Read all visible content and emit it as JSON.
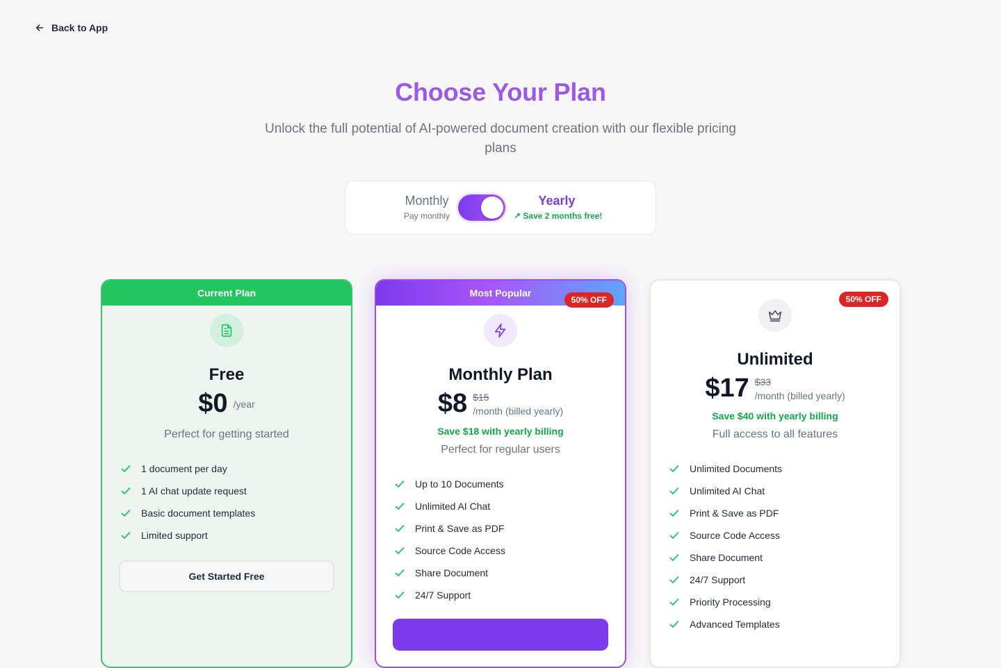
{
  "nav": {
    "back_label": "Back to App"
  },
  "hero": {
    "title": "Choose Your Plan",
    "subtitle": "Unlock the full potential of AI-powered document creation with our flexible pricing plans"
  },
  "billing_toggle": {
    "monthly_label": "Monthly",
    "monthly_sub": "Pay monthly",
    "yearly_label": "Yearly",
    "yearly_sub": "↗ Save 2 months free!",
    "selected": "Yearly"
  },
  "plans": {
    "free": {
      "banner": "Current Plan",
      "icon": "document-icon",
      "name": "Free",
      "price": "$0",
      "period": "/year",
      "tagline": "Perfect for getting started",
      "features": [
        "1 document per day",
        "1 AI chat update request",
        "Basic document templates",
        "Limited support"
      ],
      "cta": "Get Started Free"
    },
    "monthly": {
      "banner": "Most Popular",
      "discount": "50% OFF",
      "icon": "lightning-icon",
      "name": "Monthly Plan",
      "price": "$8",
      "old_price": "$15",
      "period": "/month (billed yearly)",
      "savings": "Save $18 with yearly billing",
      "tagline": "Perfect for regular users",
      "features": [
        "Up to 10 Documents",
        "Unlimited AI Chat",
        "Print & Save as PDF",
        "Source Code Access",
        "Share Document",
        "24/7 Support"
      ]
    },
    "unlimited": {
      "discount": "50% OFF",
      "icon": "crown-icon",
      "name": "Unlimited",
      "price": "$17",
      "old_price": "$33",
      "period": "/month (billed yearly)",
      "savings": "Save $40 with yearly billing",
      "tagline": "Full access to all features",
      "features": [
        "Unlimited Documents",
        "Unlimited AI Chat",
        "Print & Save as PDF",
        "Source Code Access",
        "Share Document",
        "24/7 Support",
        "Priority Processing",
        "Advanced Templates"
      ]
    }
  },
  "colors": {
    "accent_purple": "#7c3aed",
    "title_purple": "#9b59e6",
    "success_green": "#22c55e",
    "discount_red": "#dc2626"
  }
}
